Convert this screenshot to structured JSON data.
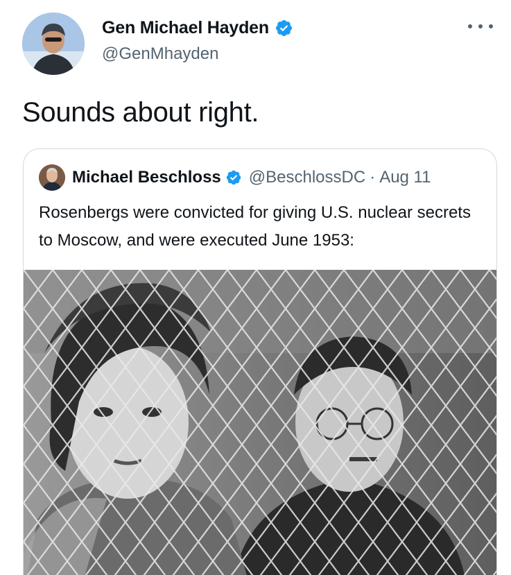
{
  "author": {
    "name": "Gen Michael Hayden",
    "handle": "@GenMhayden",
    "verified": true,
    "avatar_icon": "profile-photo"
  },
  "more_icon": "more-options-icon",
  "tweet": {
    "text": "Sounds about right."
  },
  "quoted": {
    "name": "Michael Beschloss",
    "handle": "@BeschlossDC",
    "separator": "·",
    "date": "Aug 11",
    "verified": true,
    "text": "Rosenbergs were convicted for giving U.S. nuclear secrets to Moscow, and were executed June 1953:",
    "photo_icon": "black-and-white-photo"
  },
  "colors": {
    "verified_blue": "#1d9bf0",
    "text_primary": "#0f1419",
    "text_secondary": "#536471",
    "border": "#cfd9de"
  }
}
